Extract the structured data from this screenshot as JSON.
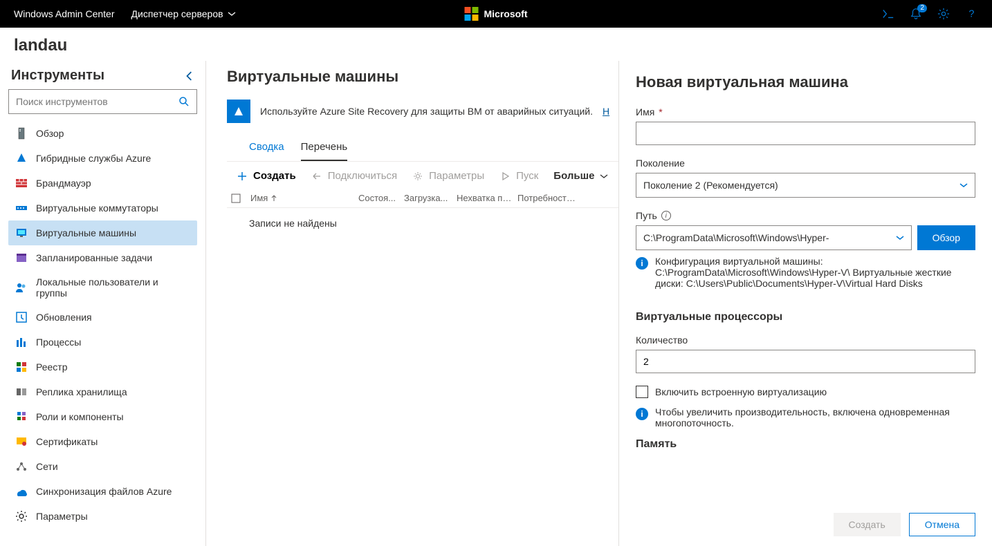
{
  "header": {
    "app_name": "Windows Admin Center",
    "context_menu": "Диспетчер серверов",
    "brand": "Microsoft",
    "notification_count": "2"
  },
  "server_name": "landau",
  "sidebar": {
    "title": "Инструменты",
    "search_placeholder": "Поиск инструментов",
    "items": [
      {
        "label": "Обзор"
      },
      {
        "label": "Гибридные службы Azure"
      },
      {
        "label": "Брандмауэр"
      },
      {
        "label": "Виртуальные коммутаторы"
      },
      {
        "label": "Виртуальные машины"
      },
      {
        "label": "Запланированные задачи"
      },
      {
        "label": "Локальные пользователи и группы"
      },
      {
        "label": "Обновления"
      },
      {
        "label": "Процессы"
      },
      {
        "label": "Реестр"
      },
      {
        "label": "Реплика хранилища"
      },
      {
        "label": "Роли и компоненты"
      },
      {
        "label": "Сертификаты"
      },
      {
        "label": "Сети"
      },
      {
        "label": "Синхронизация файлов Azure"
      },
      {
        "label": "Параметры"
      }
    ]
  },
  "main": {
    "title": "Виртуальные машины",
    "banner_text": "Используйте Azure Site Recovery для защиты ВМ от аварийных ситуаций.",
    "banner_link": "Н",
    "tabs": [
      {
        "label": "Сводка"
      },
      {
        "label": "Перечень"
      }
    ],
    "commands": {
      "create": "Создать",
      "connect": "Подключиться",
      "settings": "Параметры",
      "start": "Пуск",
      "more": "Больше"
    },
    "columns": {
      "name": "Имя",
      "state": "Состоя...",
      "load": "Загрузка...",
      "memshort": "Нехватка па...",
      "memneed": "Потребность в па..."
    },
    "empty_text": "Записи не найдены"
  },
  "flyout": {
    "title": "Новая виртуальная машина",
    "name_label": "Имя",
    "name_value": "",
    "gen_label": "Поколение",
    "gen_value": "Поколение 2 (Рекомендуется)",
    "path_label": "Путь",
    "path_value": "C:\\ProgramData\\Microsoft\\Windows\\Hyper-",
    "browse": "Обзор",
    "path_info": "Конфигурация виртуальной машины: C:\\ProgramData\\Microsoft\\Windows\\Hyper-V\\ Виртуальные жесткие диски: C:\\Users\\Public\\Documents\\Hyper-V\\Virtual Hard Disks",
    "vproc_title": "Виртуальные процессоры",
    "count_label": "Количество",
    "count_value": "2",
    "nested_label": "Включить встроенную виртуализацию",
    "nested_info": "Чтобы увеличить производительность, включена одновременная многопоточность.",
    "memory_title": "Память",
    "create_btn": "Создать",
    "cancel_btn": "Отмена"
  }
}
